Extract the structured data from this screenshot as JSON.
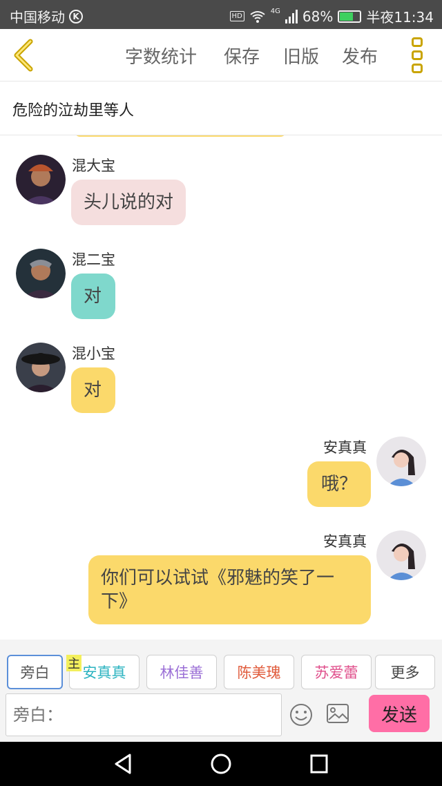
{
  "status": {
    "carrier": "中国移动",
    "k_badge": "K",
    "hd": "HD",
    "network": "4G",
    "battery": "68%",
    "battery_level": 0.68,
    "time": "半夜11:34"
  },
  "header": {
    "word_count": "字数统计",
    "save": "保存",
    "old_version": "旧版",
    "publish": "发布"
  },
  "title": "危险的泣劫里等人",
  "messages": [
    {
      "speaker": "混大宝",
      "text": "头儿说的对",
      "side": "left",
      "bubble_color": "#f5dede"
    },
    {
      "speaker": "混二宝",
      "text": "对",
      "side": "left",
      "bubble_color": "#7fd8cc"
    },
    {
      "speaker": "混小宝",
      "text": "对",
      "side": "left",
      "bubble_color": "#fbd96b"
    },
    {
      "speaker": "安真真",
      "text": "哦？",
      "side": "right",
      "bubble_color": "#fbd96b"
    },
    {
      "speaker": "安真真",
      "text": "你们可以试试《邪魅的笑了一下》",
      "side": "right",
      "bubble_color": "#fbd96b"
    }
  ],
  "roles": {
    "narration": "旁白",
    "main_badge": "主",
    "r1": "安真真",
    "r2": "林佳善",
    "r3": "陈美瑰",
    "r4": "苏爱蕾",
    "more": "更多",
    "colors": {
      "r1": "#2bb3c0",
      "r2": "#9b6fd6",
      "r3": "#e05a3a",
      "r4": "#e0508c"
    }
  },
  "composer": {
    "placeholder": "旁白：",
    "send": "发送"
  }
}
